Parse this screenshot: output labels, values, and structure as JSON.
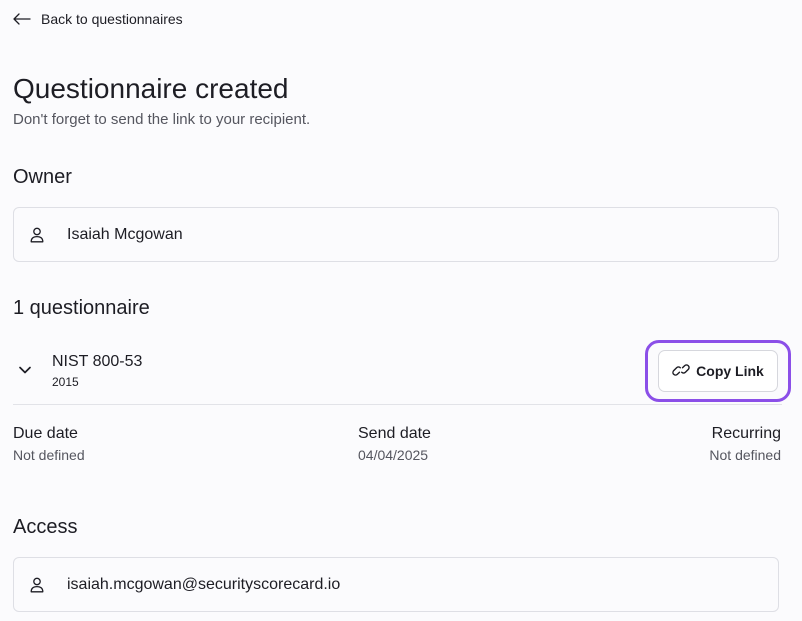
{
  "nav": {
    "back_label": "Back to questionnaires",
    "back_icon": "arrow-left-icon"
  },
  "header": {
    "title": "Questionnaire created",
    "subtitle": "Don't forget to send the link to your recipient."
  },
  "owner": {
    "heading": "Owner",
    "name": "Isaiah Mcgowan",
    "icon": "person-icon"
  },
  "questionnaires": {
    "heading": "1 questionnaire",
    "items": [
      {
        "name": "NIST 800-53",
        "version": "2015",
        "copy_label": "Copy Link",
        "copy_icon": "link-icon",
        "expand_icon": "chevron-down-icon",
        "due_date_label": "Due date",
        "due_date_value": "Not defined",
        "send_date_label": "Send date",
        "send_date_value": "04/04/2025",
        "recurring_label": "Recurring",
        "recurring_value": "Not defined"
      }
    ]
  },
  "access": {
    "heading": "Access",
    "email": "isaiah.mcgowan@securityscorecard.io",
    "icon": "person-icon"
  },
  "colors": {
    "accent_focus": "#8b4fe8",
    "background": "#fbfbfd",
    "text": "#1d1d24",
    "muted": "#55565f",
    "border": "#dedfe5"
  }
}
